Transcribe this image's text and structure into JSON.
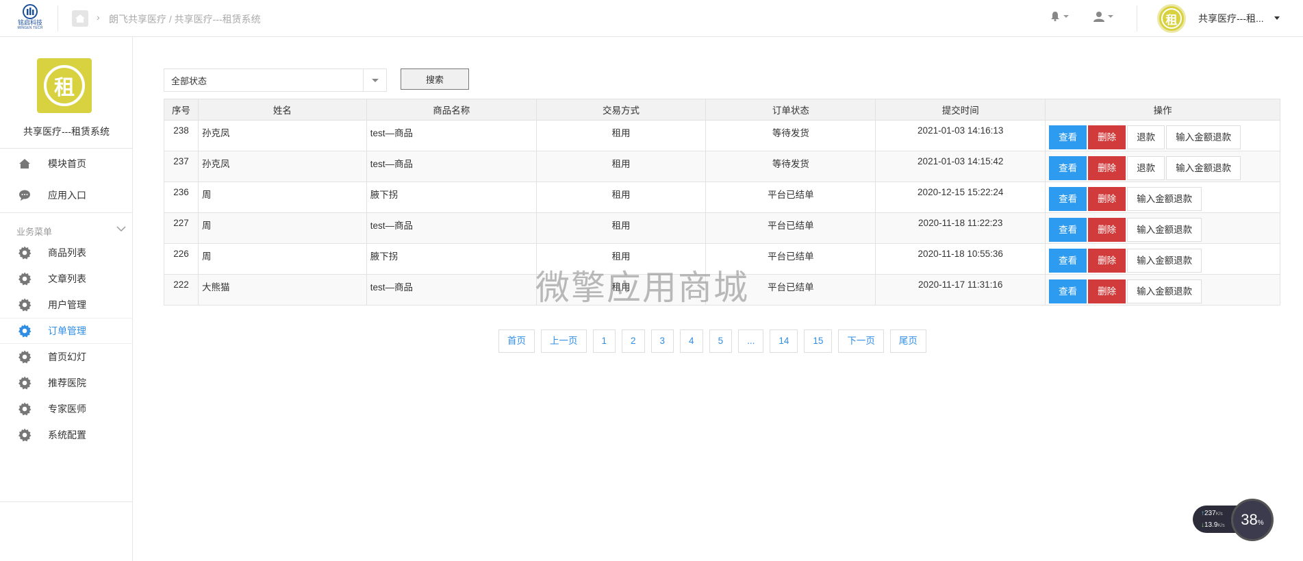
{
  "brand": {
    "name_cn": "铭启科技",
    "name_en": "MINGEN TECH"
  },
  "breadcrumb": {
    "path": "朗飞共享医疗 / 共享医疗---租赁系统"
  },
  "user": {
    "avatar_text": "租",
    "name": "共享医疗---租..."
  },
  "sidebar": {
    "logo_text": "租",
    "title": "共享医疗---租赁系统",
    "top_items": [
      {
        "label": "模块首页",
        "icon": "home-icon"
      },
      {
        "label": "应用入口",
        "icon": "chat-icon"
      }
    ],
    "group_label": "业务菜单",
    "items": [
      {
        "label": "商品列表",
        "icon": "gear-icon"
      },
      {
        "label": "文章列表",
        "icon": "gear-icon"
      },
      {
        "label": "用户管理",
        "icon": "gear-icon"
      },
      {
        "label": "订单管理",
        "icon": "gear-icon",
        "active": true
      },
      {
        "label": "首页幻灯",
        "icon": "gear-icon"
      },
      {
        "label": "推荐医院",
        "icon": "gear-icon"
      },
      {
        "label": "专家医师",
        "icon": "gear-icon"
      },
      {
        "label": "系统配置",
        "icon": "gear-icon"
      }
    ]
  },
  "filter": {
    "status_value": "全部状态",
    "search_label": "搜索"
  },
  "table": {
    "headers": [
      "序号",
      "姓名",
      "商品名称",
      "交易方式",
      "订单状态",
      "提交时间",
      "操作"
    ],
    "rows": [
      {
        "id": "238",
        "name": "孙克凤",
        "product": "test—商品",
        "mode": "租用",
        "status": "等待发货",
        "time": "2021-01-03 14:16:13",
        "refund": true
      },
      {
        "id": "237",
        "name": "孙克凤",
        "product": "test—商品",
        "mode": "租用",
        "status": "等待发货",
        "time": "2021-01-03 14:15:42",
        "refund": true
      },
      {
        "id": "236",
        "name": "周",
        "product": "腋下拐",
        "mode": "租用",
        "status": "平台已结单",
        "time": "2020-12-15 15:22:24",
        "refund": false
      },
      {
        "id": "227",
        "name": "周",
        "product": "test—商品",
        "mode": "租用",
        "status": "平台已结单",
        "time": "2020-11-18 11:22:23",
        "refund": false
      },
      {
        "id": "226",
        "name": "周",
        "product": "腋下拐",
        "mode": "租用",
        "status": "平台已结单",
        "time": "2020-11-18 10:55:36",
        "refund": false
      },
      {
        "id": "222",
        "name": "大熊猫",
        "product": "test—商品",
        "mode": "租用",
        "status": "平台已结单",
        "time": "2020-11-17 11:31:16",
        "refund": false
      }
    ],
    "actions": {
      "view": "查看",
      "delete": "删除",
      "refund": "退款",
      "refund_amount": "输入金额退款"
    }
  },
  "pagination": [
    "首页",
    "上一页",
    "1",
    "2",
    "3",
    "4",
    "5",
    "...",
    "14",
    "15",
    "下一页",
    "尾页"
  ],
  "watermark": "微擎应用商城",
  "network": {
    "up": "237",
    "down": "13.9",
    "unit": "K/s",
    "percent": "38",
    "percent_sign": "%"
  },
  "colors": {
    "accent": "#2f8de4",
    "view_btn": "#2d9bf0",
    "delete_btn": "#d23b3b",
    "logo_yellow": "#d9d240"
  }
}
